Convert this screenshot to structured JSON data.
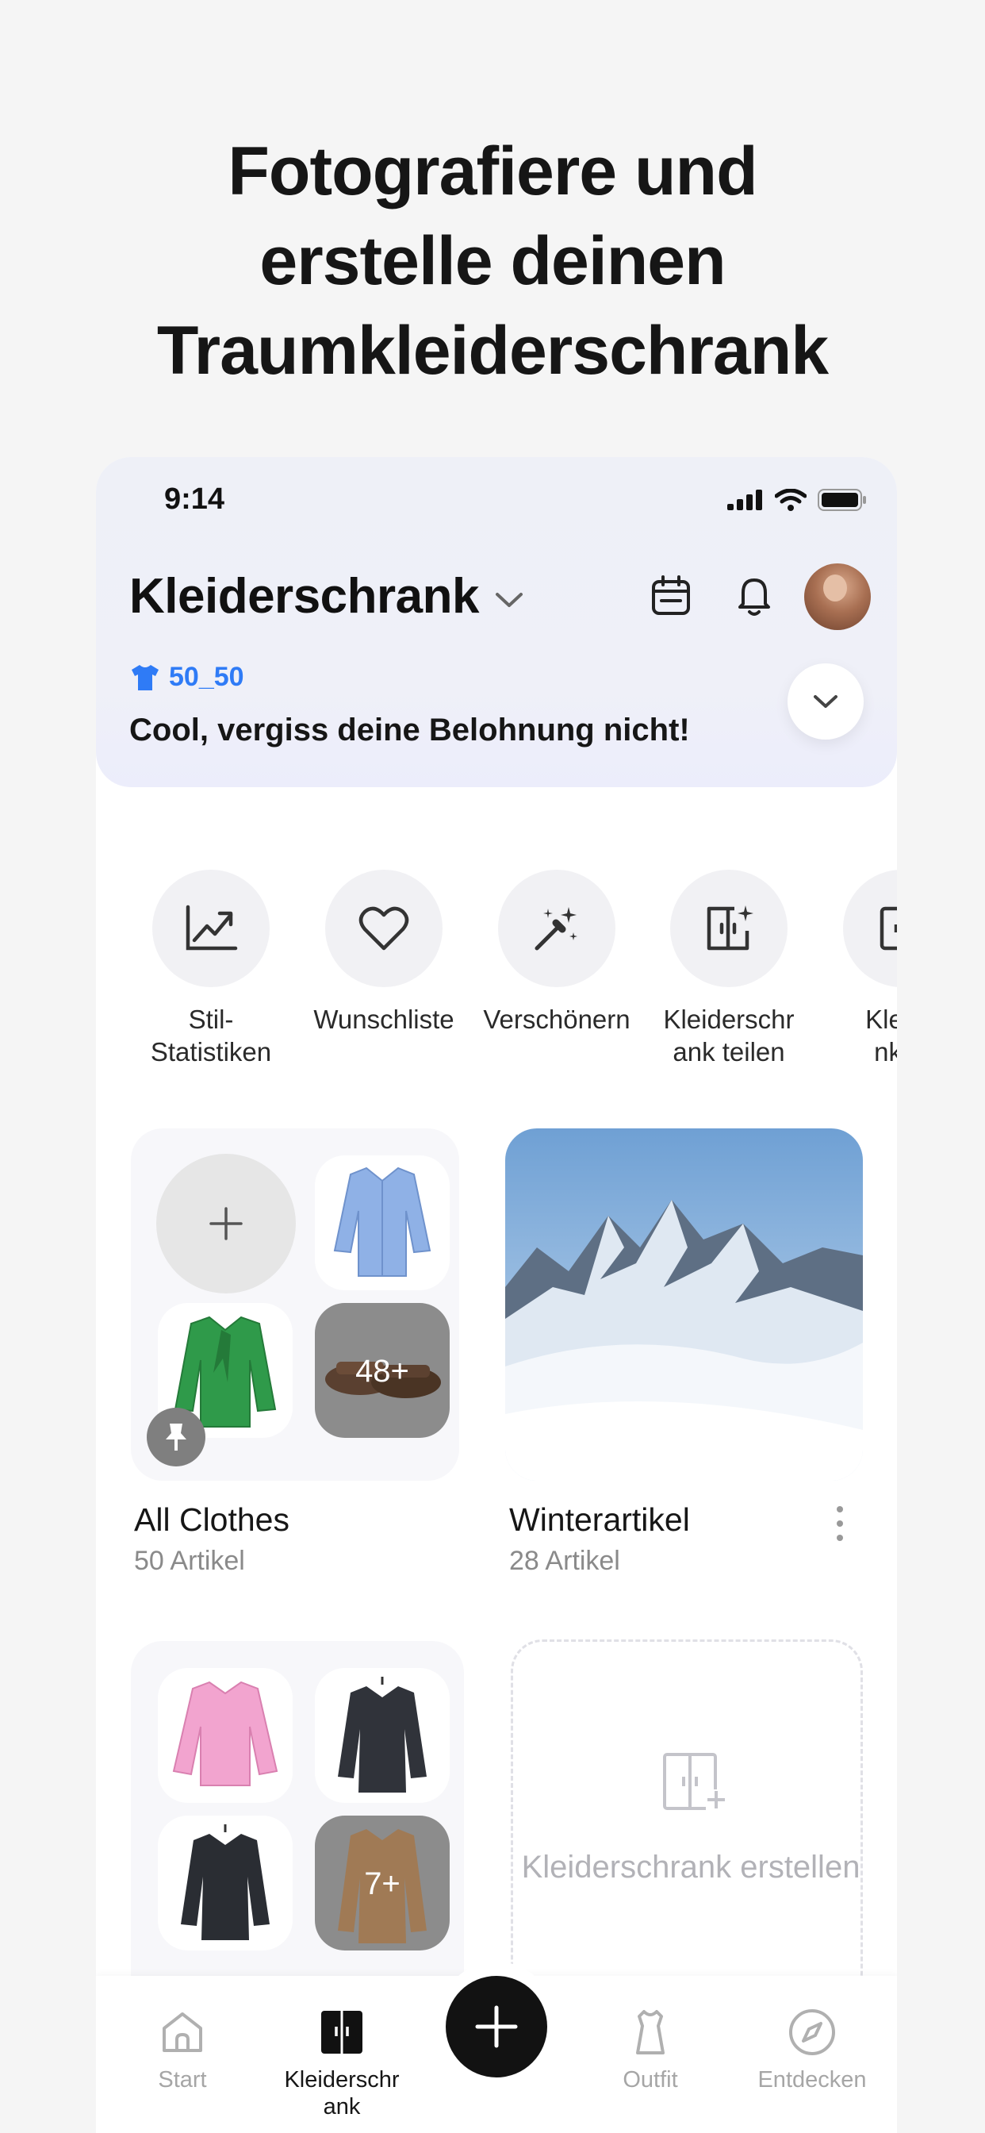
{
  "headline": [
    "Fotografiere und",
    "erstelle deinen",
    "Traumkleiderschrank"
  ],
  "status": {
    "time": "9:14"
  },
  "header": {
    "title": "Kleiderschrank",
    "tag": "50_50",
    "reward_text": "Cool, vergiss deine Belohnung nicht!"
  },
  "actions": [
    {
      "label": "Stil-\nStatistiken",
      "icon": "trend-chart-icon"
    },
    {
      "label": "Wunschliste",
      "icon": "heart-icon"
    },
    {
      "label": "Verschönern",
      "icon": "magic-wand-icon"
    },
    {
      "label": "Kleiderschr\nank teilen",
      "icon": "share-wardrobe-icon"
    },
    {
      "label": "Kleide\nnk-C",
      "icon": "wardrobe-icon"
    }
  ],
  "collections": [
    {
      "name": "All Clothes",
      "count": "50 Artikel",
      "more": "48+"
    },
    {
      "name": "Winterartikel",
      "count": "28 Artikel"
    },
    {
      "name": "",
      "count": "",
      "more": "7+"
    }
  ],
  "create_label": "Kleiderschrank erstellen",
  "tabs": [
    {
      "label": "Start",
      "icon": "home-icon"
    },
    {
      "label": "Kleiderschr\nank",
      "icon": "wardrobe-icon"
    },
    {
      "label": "Outfit",
      "icon": "outfit-icon"
    },
    {
      "label": "Entdecken",
      "icon": "compass-icon"
    }
  ],
  "colors": {
    "accent": "#2f7bf6",
    "fab": "#121212",
    "background": "#f5f5f5"
  }
}
